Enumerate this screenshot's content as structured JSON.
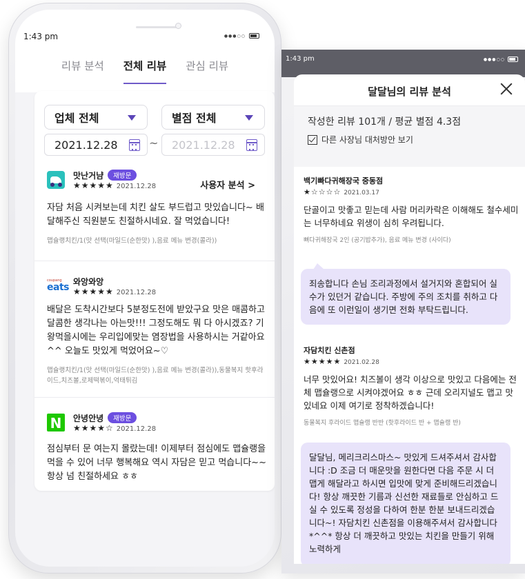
{
  "status": {
    "time_left": "1:43 pm",
    "time_right": "1:43 pm",
    "signal": "●●●○○"
  },
  "tabs": [
    {
      "label": "리뷰 분석"
    },
    {
      "label": "전체 리뷰"
    },
    {
      "label": "관심 리뷰"
    }
  ],
  "filters": {
    "store": "업체 전체",
    "rating": "별점 전체",
    "date_from": "2021.12.28",
    "date_to": "2021.12.28",
    "separator": "~"
  },
  "reviews": [
    {
      "name": "맛난거냠",
      "badge": "재방문",
      "stars": "★★★★★",
      "date": "2021.12.28",
      "action": "사용자 분석 >",
      "text": "자담 처음 시켜보는데 치킨 살도 부드럽고 맛있습니다~ 배달해주신 직원분도 친절하시네요. 잘 먹었습니다!",
      "menu": "맵슐랭치킨/1(맛 선택(마일드(순한맛) ),음료 메뉴 변경(콜라))"
    },
    {
      "name": "와앙와앙",
      "logo_small": "coupang",
      "logo_big": "eats",
      "stars": "★★★★★",
      "date": "2021.12.28",
      "text": "배달은 도착시간보다 5분정도전에 받았구요 맛은 매콤하고 달콤한 생각나는 아는맛!!! 그정도해도 뭐 다 아시겠죠? 기왕먹을시에는 우리입에맞는 염장법을 사용하시는 거같아요^^ 오늘도 맛있게 먹었어요~♡",
      "menu": "맵슐랭치킨/1(맛 선택(마일드(순한맛) ),음료 메뉴 변경(콜라)),동물복지 핫후라이드,치즈볼,로제떡볶이,억태튀김"
    },
    {
      "name": "안녕안녕",
      "badge": "재방문",
      "logo_letter": "N",
      "stars": "★★★★☆",
      "date": "2021.12.28",
      "text": "점심부터 문 여는지 몰랐는데! 이제부터 점심에도 맵슐랭을 먹을 수 있어 너무 행복해요 역시 자담은 믿고 먹습니다~~ 항상 넘 친절하세요 ㅎㅎ"
    }
  ],
  "sheet": {
    "title": "달달님의 리뷰 분석",
    "summary": "작성한 리뷰 101개 / 평균 별점 4.3점",
    "checkbox_label": "다른 사장님 대처방안 보기",
    "items": [
      {
        "store": "백기빠다귀해장국 중동점",
        "stars": "★☆☆☆☆",
        "date": "2021.03.17",
        "text": "단골이고 맛좋고 믿는데 사람 머리카락은 이해해도 철수세미는 너무하네요 위생이 심히 우려됩니다.",
        "menu": "뼈다귀해장국 2인 (공기밥추가), 음료 메뉴 변경 (사이다)",
        "reply": "죄송합니다 손님 조리과정에서 설거지와 혼합되어 실수가 있던거 같습니다. 주방에 주의 조치를 취하고 다음에 또 이런일이 생기면 전화 부탁드립니다."
      },
      {
        "store": "자담치킨 신촌점",
        "stars": "★★★★★",
        "date": "2021.02.28",
        "text": "너무 맛있어요! 치즈볼이 생각 이상으로 맛있고 다음에는 전체 맵슐랭으로 시켜야겠어요 ㅎㅎ 근데 오리지널도 맵고 맛있네요 이제 여기로 정착하겠습니다!",
        "menu": "동물복지 후라이드 맵슐랭 반반 (핫후라이드 반 + 맵슐랭 반)",
        "reply": "달달님, 메리크리스마스~ 맛있게 드셔주셔서 감사합니다 :D 조금 더 매운맛을 원한다면 다음 주문 시 더 맵게 해달라고 하시면 입맛에 맞게 준비해드리겠습니다! 항상  깨끗한 기름과 신선한 재료들로 안심하고 드실 수 있도록 정성을 다하여 한분 한분 보내드리겠습니다~! 자담치킨 신촌점을 이용해주셔서 감사합니다 *^^* 항상 더 깨끗하고 맛있는 치킨을 만들기 위해 노력하게"
      }
    ]
  }
}
